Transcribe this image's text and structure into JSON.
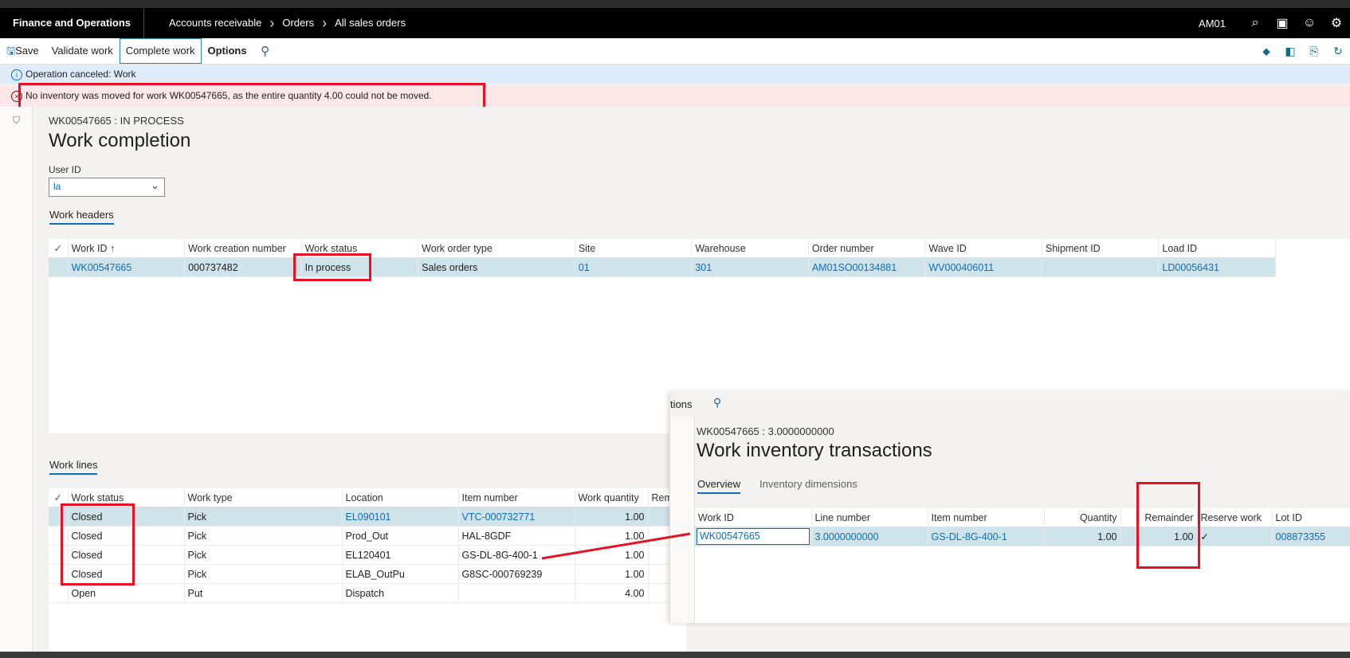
{
  "nav": {
    "app_title": "Finance and Operations",
    "breadcrumbs": [
      "Accounts receivable",
      "Orders",
      "All sales orders"
    ],
    "company": "AM01"
  },
  "actions": {
    "save": "Save",
    "validate": "Validate work",
    "complete": "Complete work",
    "options": "Options"
  },
  "messages": {
    "info": "Operation canceled: Work",
    "error": "No inventory was moved for work WK00547665, as the entire quantity 4.00 could not be moved."
  },
  "page": {
    "caption": "WK00547665 : IN PROCESS",
    "title": "Work completion",
    "user_id_label": "User ID",
    "user_id_value": "la"
  },
  "headers": {
    "section_title": "Work headers",
    "columns": [
      "Work ID ↑",
      "Work creation number",
      "Work status",
      "Work order type",
      "Site",
      "Warehouse",
      "Order number",
      "Wave ID",
      "Shipment ID",
      "Load ID"
    ],
    "rows": [
      [
        "WK00547665",
        "000737482",
        "In process",
        "Sales orders",
        "01",
        "301",
        "AM01SO00134881",
        "WV000406011",
        "",
        "LD00056431"
      ]
    ]
  },
  "lines": {
    "section_title": "Work lines",
    "columns": [
      "Work status",
      "Work type",
      "Location",
      "Item number",
      "Work quantity",
      "Rem"
    ],
    "rows": [
      [
        "Closed",
        "Pick",
        "EL090101",
        "VTC-000732771",
        "1.00",
        ""
      ],
      [
        "Closed",
        "Pick",
        "Prod_Out",
        "HAL-8GDF",
        "1.00",
        ""
      ],
      [
        "Closed",
        "Pick",
        "EL120401",
        "GS-DL-8G-400-1",
        "1.00",
        ""
      ],
      [
        "Closed",
        "Pick",
        "ELAB_OutPu",
        "G8SC-000769239",
        "1.00",
        ""
      ],
      [
        "Open",
        "Put",
        "Dispatch",
        "",
        "4.00",
        ""
      ]
    ]
  },
  "panel": {
    "options": "tions",
    "caption": "WK00547665 : 3.0000000000",
    "title": "Work inventory transactions",
    "tabs": [
      "Overview",
      "Inventory dimensions"
    ],
    "columns": [
      "Work ID",
      "Line number",
      "Item number",
      "Quantity",
      "Remainder",
      "Reserve work",
      "Lot ID"
    ],
    "rows": [
      [
        "WK00547665",
        "3.0000000000",
        "GS-DL-8G-400-1",
        "1.00",
        "1.00",
        "✓",
        "008873355"
      ]
    ]
  },
  "colors": {
    "accent": "#0f6cbd",
    "highlight_box": "#e81123",
    "error_bg": "#fde7e9",
    "info_bg": "#deecf9",
    "selected_row": "#cfe4ea"
  }
}
